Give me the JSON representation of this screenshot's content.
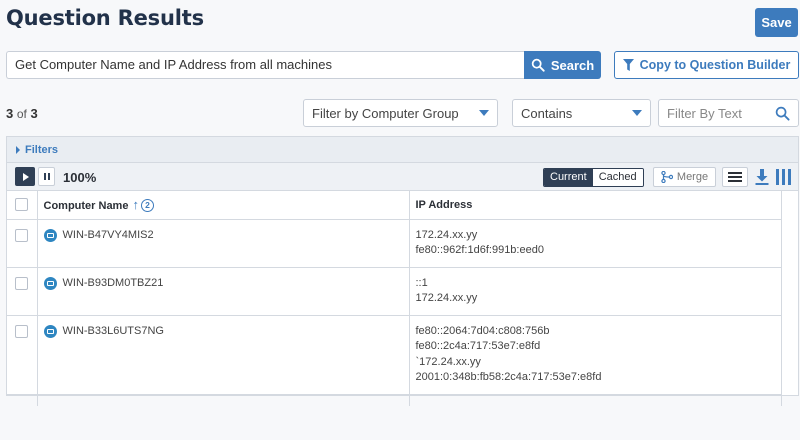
{
  "header": {
    "title": "Question Results",
    "save_label": "Save"
  },
  "question": {
    "value": "Get Computer Name and IP Address from all machines",
    "search_label": "Search",
    "copy_label": "Copy to Question Builder"
  },
  "results": {
    "shown": "3",
    "of_label": "of",
    "total": "3"
  },
  "filters": {
    "computer_group_placeholder": "Filter by Computer Group",
    "match_mode": "Contains",
    "text_placeholder": "Filter By Text",
    "filters_label": "Filters"
  },
  "toolbar": {
    "progress": "100%",
    "current_label": "Current",
    "cached_label": "Cached",
    "merge_label": "Merge",
    "active_view": "Current"
  },
  "table": {
    "columns": [
      "Computer Name",
      "IP Address"
    ],
    "sort_order": "2",
    "rows": [
      {
        "computer": "WIN-B47VY4MIS2",
        "ips": [
          "172.24.xx.yy",
          "fe80::962f:1d6f:991b:eed0"
        ]
      },
      {
        "computer": "WIN-B93DM0TBZ21",
        "ips": [
          "::1",
          "172.24.xx.yy"
        ]
      },
      {
        "computer": "WIN-B33L6UTS7NG",
        "ips": [
          "fe80::2064:7d04:c808:756b",
          "fe80::2c4a:717:53e7:e8fd",
          "`172.24.xx.yy",
          "2001:0:348b:fb58:2c4a:717:53e7:e8fd"
        ]
      }
    ]
  },
  "colors": {
    "accent": "#3d7bbd",
    "dark": "#2f3f55",
    "title": "#22324a"
  },
  "icons": [
    "search-icon",
    "funnel-icon",
    "play-icon",
    "pause-icon",
    "merge-icon",
    "menu-icon",
    "download-icon",
    "columns-icon",
    "computer-icon"
  ]
}
